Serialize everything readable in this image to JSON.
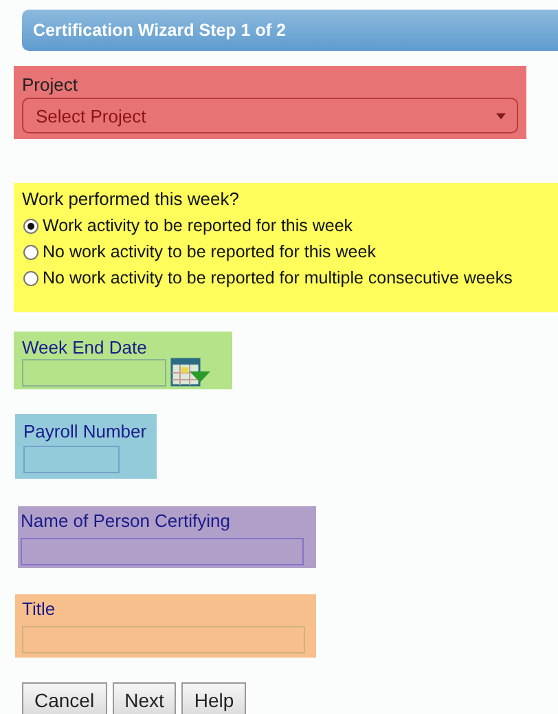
{
  "header": {
    "title": "Certification Wizard Step 1 of 2"
  },
  "sections": [
    {
      "kind": "select",
      "color": "#e87374",
      "label": "Project",
      "value": "Select Project"
    },
    {
      "kind": "radio",
      "color": "#fefd5c",
      "label": "Work performed this week?",
      "options": [
        {
          "label": "Work activity to be reported for this week",
          "selected": true
        },
        {
          "label": "No work activity to be reported for this week",
          "selected": false
        },
        {
          "label": "No work activity to be reported for multiple consecutive weeks",
          "selected": false
        }
      ]
    },
    {
      "kind": "date",
      "color": "#b4e38a",
      "label": "Week End Date"
    },
    {
      "kind": "text",
      "color": "#94cbdb",
      "label": "Payroll Number"
    },
    {
      "kind": "text",
      "color": "#b0a0c9",
      "label": "Name of Person Certifying"
    },
    {
      "kind": "text",
      "color": "#f6bf8c",
      "label": "Title"
    }
  ],
  "buttons": [
    "Cancel",
    "Next",
    "Help"
  ]
}
